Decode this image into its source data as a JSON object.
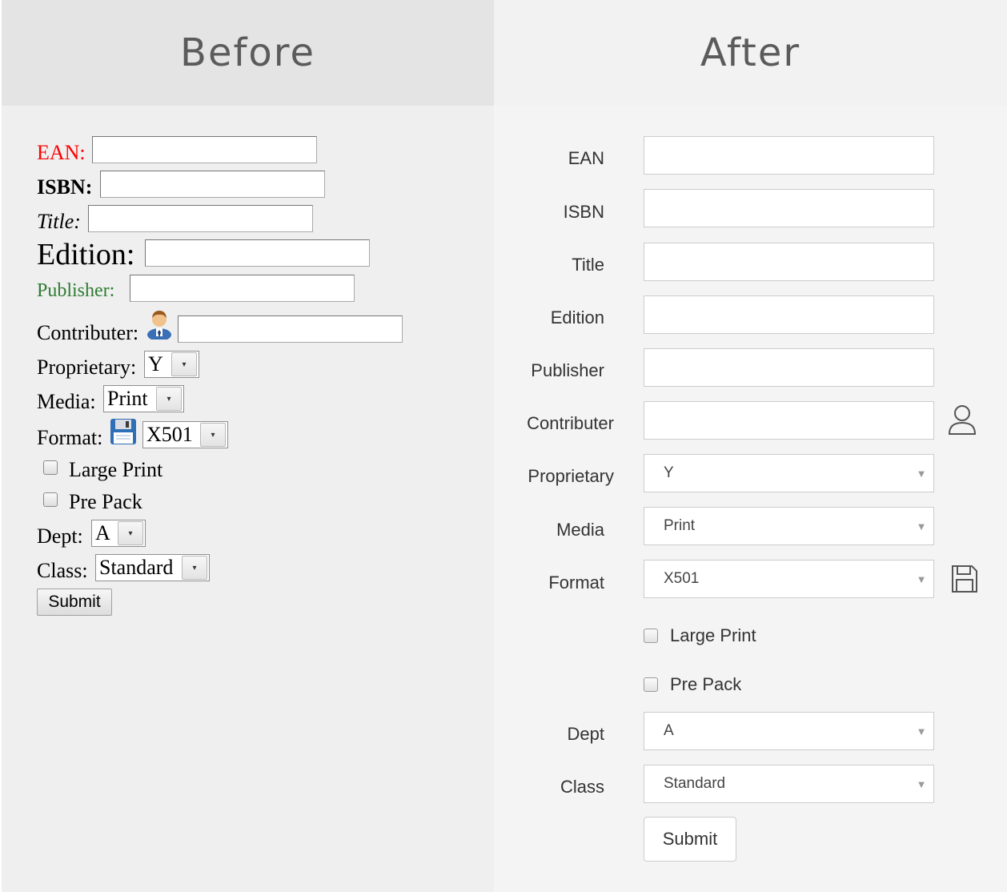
{
  "before": {
    "title": "Before",
    "fields": {
      "ean": "EAN:",
      "isbn": "ISBN:",
      "title": "Title:",
      "edition": "Edition:",
      "publisher": "Publisher:",
      "contributer": "Contributer:",
      "proprietary": "Proprietary:",
      "media": "Media:",
      "format": "Format:",
      "dept": "Dept:",
      "class": "Class:"
    },
    "selects": {
      "proprietary": "Y",
      "media": "Print",
      "format": "X501",
      "dept": "A",
      "class": "Standard"
    },
    "checkboxes": {
      "large_print": "Large Print",
      "pre_pack": "Pre Pack"
    },
    "submit_label": "Submit",
    "colors": {
      "ean_label": "#ff0000",
      "publisher_label": "#2e7d32"
    }
  },
  "after": {
    "title": "After",
    "fields": {
      "ean": "EAN",
      "isbn": "ISBN",
      "title": "Title",
      "edition": "Edition",
      "publisher": "Publisher",
      "contributer": "Contributer",
      "proprietary": "Proprietary",
      "media": "Media",
      "format": "Format",
      "dept": "Dept",
      "class": "Class"
    },
    "selects": {
      "proprietary": "Y",
      "media": "Print",
      "format": "X501",
      "dept": "A",
      "class": "Standard"
    },
    "checkboxes": {
      "large_print": "Large Print",
      "pre_pack": "Pre Pack"
    },
    "submit_label": "Submit",
    "icons": {
      "contributer": "user-icon",
      "format": "save-icon"
    }
  }
}
